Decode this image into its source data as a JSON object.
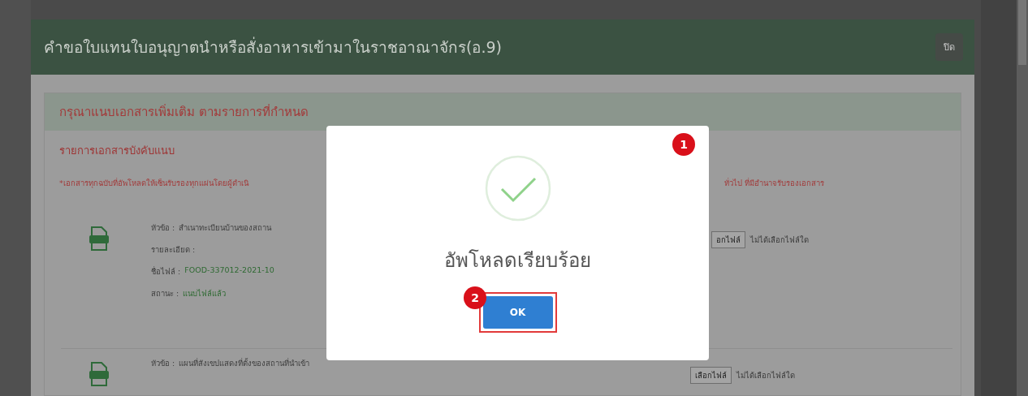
{
  "modal": {
    "title": "คำขอใบแทนใบอนุญาตนำหรือสั่งอาหารเข้ามาในราชอาณาจักร(อ.9)",
    "close_button": "ปิด"
  },
  "panel": {
    "heading": "กรุณาแนบเอกสารเพิ่มเติม ตามรายการที่กำหนด",
    "subheading": "รายการเอกสารบังคับแนบ",
    "note_left": "*เอกสารทุกฉบับที่อัพโหลดให้เซ็นรับรองทุกแผ่นโดยผู้ดำเนิ",
    "note_right": "ทั่วไป ที่มีอำนาจรับรองเอกสาร"
  },
  "documents": [
    {
      "lines": [
        {
          "label": "หัวข้อ :",
          "value": "สำเนาทะเบียนบ้านของสถาน",
          "kind": "plain"
        },
        {
          "label": "รายละเอียด :"
        },
        {
          "label": "ชื่อไฟล์ :",
          "value": "FOOD-337012-2021-10",
          "kind": "highlight"
        },
        {
          "label": "สถานะ :",
          "value": "แนบไฟล์แล้ว",
          "kind": "highlight"
        }
      ],
      "choose_button": "อกไฟล์",
      "file_status": "ไม่ได้เลือกไฟล์ใด",
      "partly_hidden": true
    },
    {
      "lines": [
        {
          "label": "หัวข้อ :",
          "value": "แผนที่สังเขปแสดงที่ตั้งของสถานที่นำเข้า",
          "kind": "plain"
        }
      ],
      "choose_button": "เลือกไฟล์",
      "file_status": "ไม่ได้เลือกไฟล์ใด",
      "partly_hidden": false
    }
  ],
  "dialog": {
    "message": "อัพโหลดเรียบร้อย",
    "ok_button": "OK",
    "step_badges": [
      "1",
      "2"
    ]
  }
}
